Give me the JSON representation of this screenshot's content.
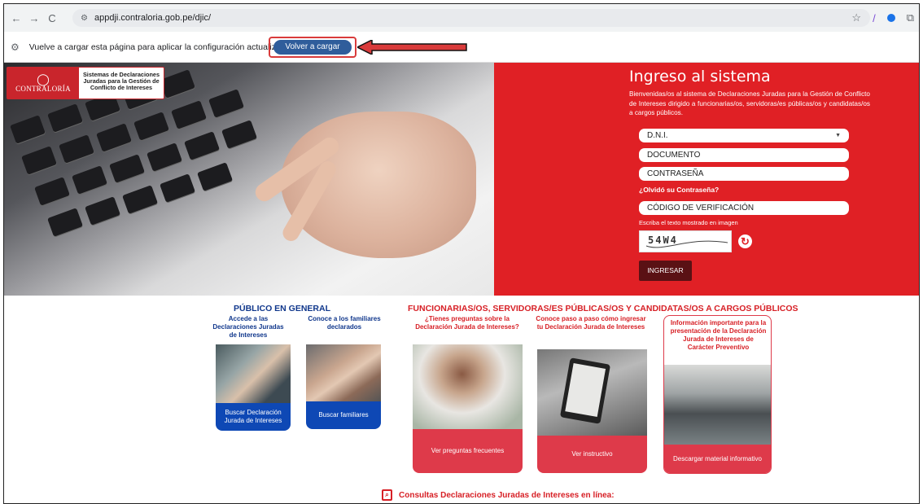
{
  "browser": {
    "url": "appdji.contraloria.gob.pe/djic/",
    "info_message": "Vuelve a cargar esta página para aplicar la configuración actualizada a este sitio",
    "reload_label": "Volver a cargar"
  },
  "header": {
    "logo_name": "CONTRALORÍA",
    "logo_subtitle": "Sistemas de Declaraciones Juradas para la Gestión de Conflicto de Intereses"
  },
  "login": {
    "title": "Ingreso al sistema",
    "intro": "Bienvenidas/os al sistema de Declaraciones Juradas para la Gestión de Conflicto de Intereses dirigido a funcionarias/os, servidoras/es públicas/os y candidatas/os a cargos públicos.",
    "doc_type": "D.N.I.",
    "document_placeholder": "DOCUMENTO",
    "password_placeholder": "CONTRASEÑA",
    "forgot": "¿Olvidó su Contraseña?",
    "verification_placeholder": "CÓDIGO DE VERIFICACIÓN",
    "captcha_hint": "Escriba el texto mostrado en imagen",
    "captcha_text": "54W4",
    "submit": "INGRESAR"
  },
  "public": {
    "title": "PÚBLICO EN GENERAL",
    "cards": [
      {
        "caption": "Accede a las Declaraciones Juradas de Intereses",
        "cta": "Buscar Declaración Jurada de Intereses"
      },
      {
        "caption": "Conoce a los familiares declarados",
        "cta": "Buscar familiares"
      }
    ]
  },
  "officials": {
    "title": "FUNCIONARIAS/OS, SERVIDORAS/ES PÚBLICAS/OS Y CANDIDATAS/OS A CARGOS PÚBLICOS",
    "cards": [
      {
        "caption": "¿Tienes preguntas sobre la Declaración Jurada de Intereses?",
        "cta": "Ver preguntas frecuentes"
      },
      {
        "caption": "Conoce paso a paso cómo ingresar tu Declaración Jurada de Intereses",
        "cta": "Ver instructivo"
      },
      {
        "caption": "Información importante para la presentación de la Declaración Jurada de Intereses de Carácter Preventivo",
        "cta": "Descargar material informativo"
      }
    ]
  },
  "footer": {
    "consultas": "Consultas Declaraciones Juradas de Intereses en línea:"
  },
  "colors": {
    "brand_red": "#e02025",
    "public_blue": "#10378c",
    "cta_blue": "#0e48b5",
    "cta_red": "#de3a4a"
  }
}
